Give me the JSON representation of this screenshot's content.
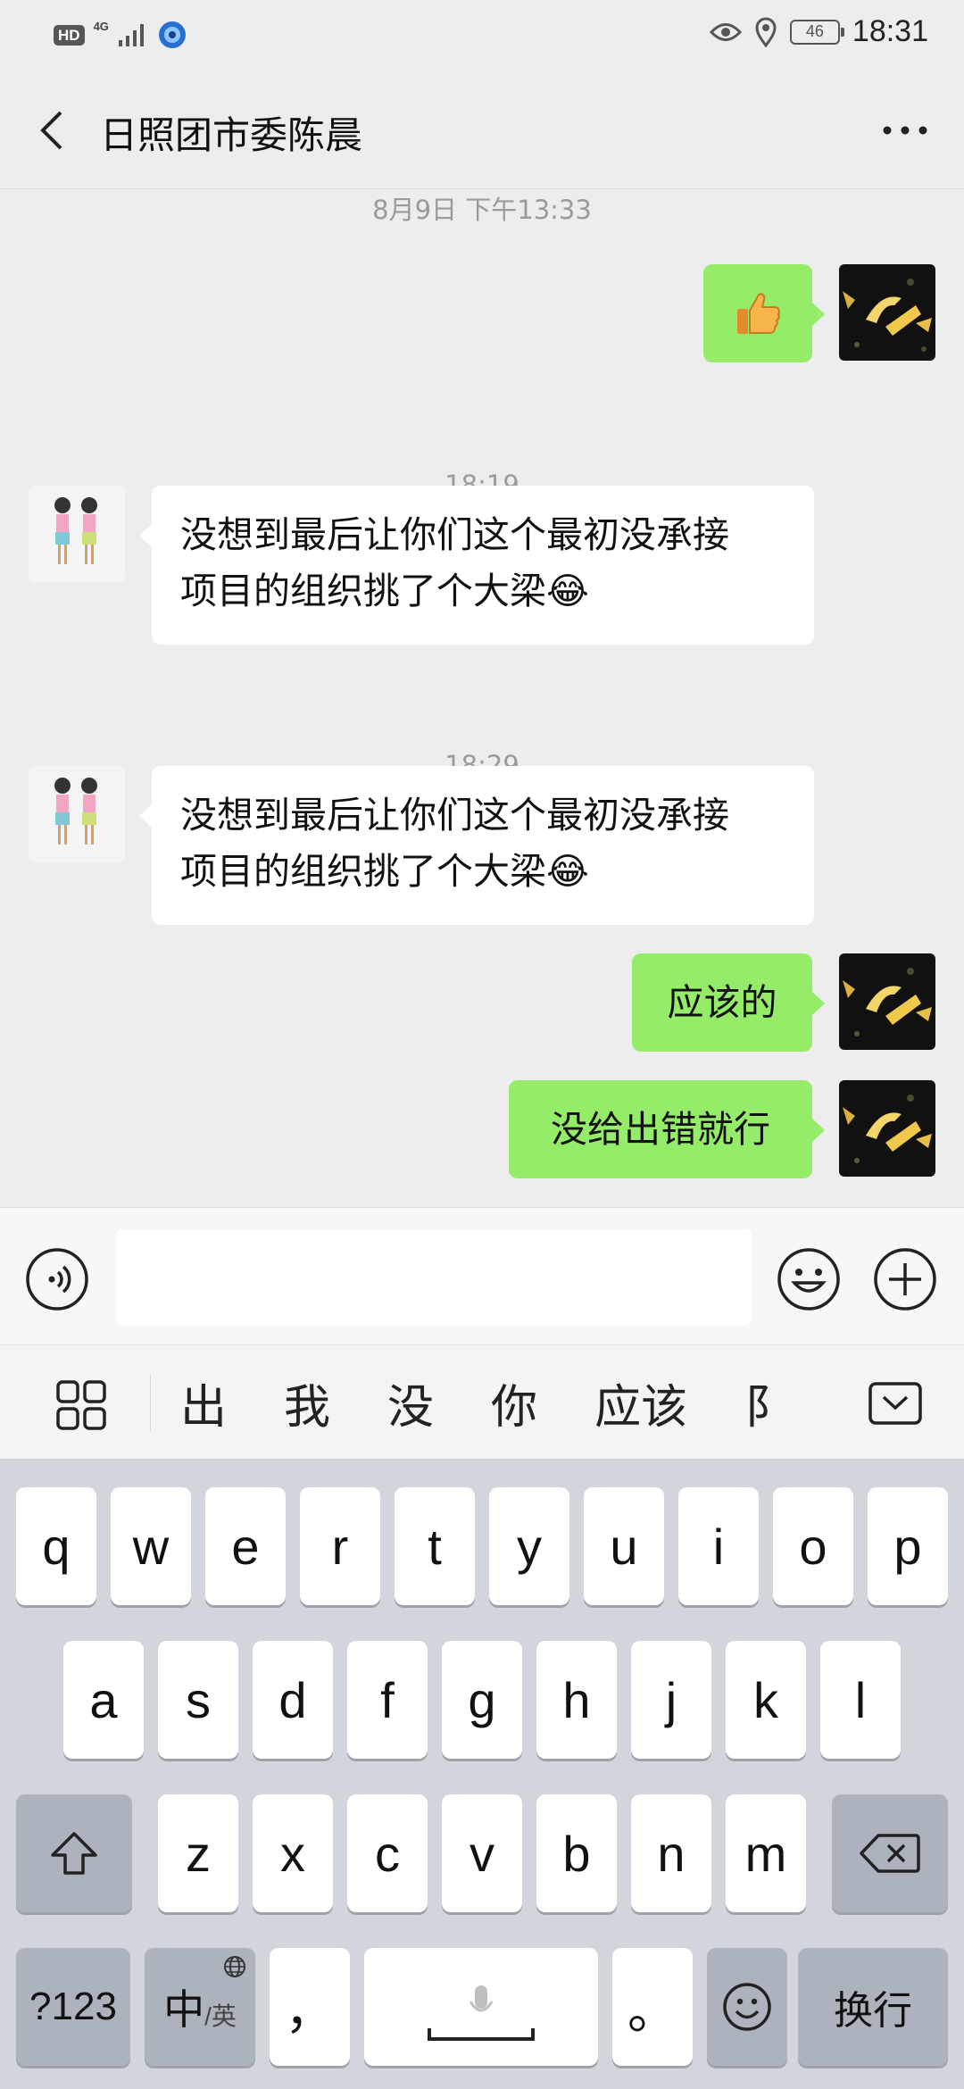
{
  "status_bar": {
    "hd": "HD",
    "network": "4G",
    "battery": "46",
    "time": "18:31"
  },
  "header": {
    "title": "日照团市委陈晨"
  },
  "messages": [
    {
      "type": "timestamp",
      "text": "8月9日 下午13:33"
    },
    {
      "type": "out",
      "kind": "emoji",
      "text": "👍"
    },
    {
      "type": "timestamp",
      "text": "18:19"
    },
    {
      "type": "in",
      "line1": "没想到最后让你们这个最初没承接",
      "line2": "项目的组织挑了个大梁😂"
    },
    {
      "type": "timestamp",
      "text": "18:29"
    },
    {
      "type": "in",
      "line1": "没想到最后让你们这个最初没承接",
      "line2": "项目的组织挑了个大梁😂"
    },
    {
      "type": "out",
      "text": "应该的"
    },
    {
      "type": "out",
      "text": "没给出错就行"
    }
  ],
  "candidates": [
    "出",
    "我",
    "没",
    "你",
    "应该",
    "阝"
  ],
  "keyboard": {
    "row1": [
      "q",
      "w",
      "e",
      "r",
      "t",
      "y",
      "u",
      "i",
      "o",
      "p"
    ],
    "row2": [
      "a",
      "s",
      "d",
      "f",
      "g",
      "h",
      "j",
      "k",
      "l"
    ],
    "row3": [
      "z",
      "x",
      "c",
      "v",
      "b",
      "n",
      "m"
    ],
    "numbers_key": "?123",
    "lang_main": "中",
    "lang_sub": "/英",
    "comma": "，",
    "period": "。",
    "enter": "换行"
  },
  "colors": {
    "outgoing_bubble": "#95ec69",
    "incoming_bubble": "#ffffff",
    "background": "#ededed"
  }
}
